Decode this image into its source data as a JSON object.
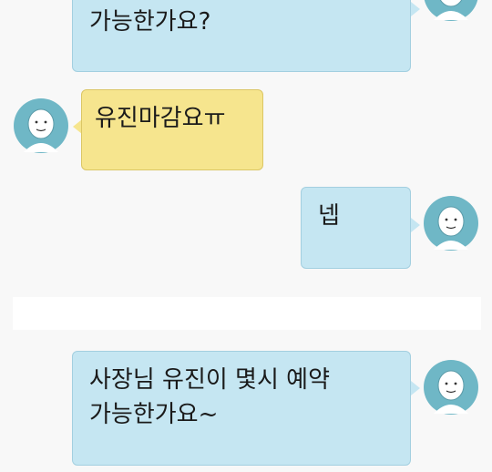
{
  "messages": [
    {
      "sender": "other",
      "text": "가능한가요?"
    },
    {
      "sender": "me",
      "text": "유진마감요ㅠ"
    },
    {
      "sender": "other",
      "text": "넵"
    },
    {
      "sender": "other",
      "text": "사장님 유진이 몇시 예약\n가능한가요~"
    }
  ],
  "colors": {
    "background": "#f8f8f8",
    "incoming_bubble": "#c5e6f2",
    "outgoing_bubble": "#f6e58e",
    "avatar_bg": "#6fb7c6"
  },
  "icons": {
    "avatar": "person-avatar-icon"
  }
}
